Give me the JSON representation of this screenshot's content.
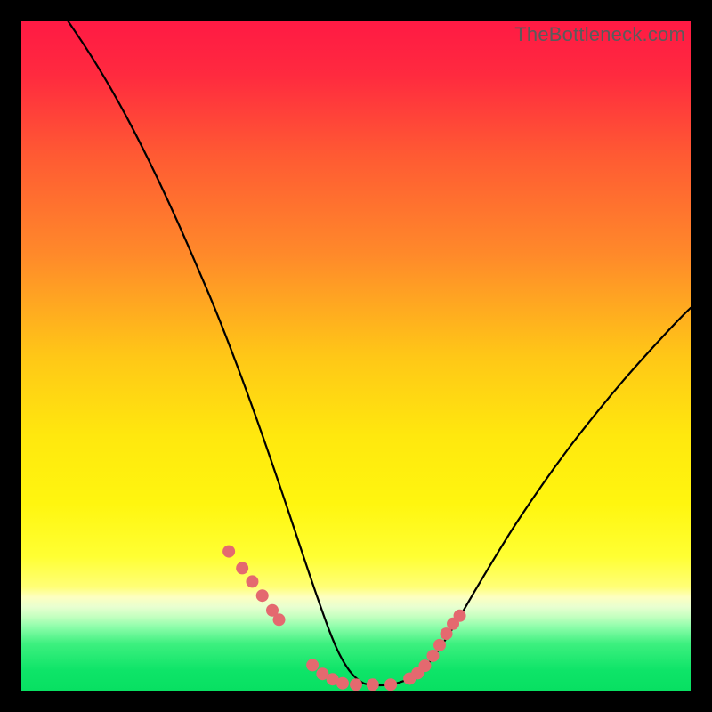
{
  "watermark": "TheBottleneck.com",
  "chart_data": {
    "type": "line",
    "title": "",
    "xlabel": "",
    "ylabel": "",
    "xlim": [
      0,
      100
    ],
    "ylim": [
      0,
      100
    ],
    "grid": false,
    "legend": false,
    "gradient_stops": [
      {
        "offset": 0.0,
        "color": "#ff1a44"
      },
      {
        "offset": 0.08,
        "color": "#ff2a3f"
      },
      {
        "offset": 0.2,
        "color": "#ff5a33"
      },
      {
        "offset": 0.35,
        "color": "#ff8a2a"
      },
      {
        "offset": 0.5,
        "color": "#ffc717"
      },
      {
        "offset": 0.62,
        "color": "#ffe80e"
      },
      {
        "offset": 0.72,
        "color": "#fff60f"
      },
      {
        "offset": 0.8,
        "color": "#ffff33"
      },
      {
        "offset": 0.845,
        "color": "#ffff77"
      },
      {
        "offset": 0.86,
        "color": "#fdffc0"
      },
      {
        "offset": 0.875,
        "color": "#e8ffd0"
      },
      {
        "offset": 0.89,
        "color": "#c2ffbf"
      },
      {
        "offset": 0.905,
        "color": "#8dfdaa"
      },
      {
        "offset": 0.93,
        "color": "#3df07f"
      },
      {
        "offset": 0.97,
        "color": "#0ee468"
      },
      {
        "offset": 1.0,
        "color": "#08e062"
      }
    ],
    "series": [
      {
        "name": "bottleneck-curve",
        "x": [
          7,
          10,
          13,
          16,
          19,
          22,
          25,
          28,
          30,
          32,
          34,
          36,
          38,
          40,
          42,
          44,
          46,
          47.5,
          49,
          50.5,
          52,
          55,
          58,
          60,
          62,
          65,
          68,
          71,
          74,
          78,
          82,
          86,
          90,
          94,
          98,
          100
        ],
        "y": [
          100,
          95.5,
          90.6,
          85.2,
          79.3,
          73.0,
          66.3,
          59.3,
          54.4,
          49.2,
          43.8,
          38.2,
          32.4,
          26.5,
          20.5,
          14.6,
          9.0,
          5.5,
          3.0,
          1.5,
          0.9,
          0.9,
          1.8,
          3.2,
          5.6,
          10.2,
          15.3,
          20.3,
          25.1,
          31.0,
          36.5,
          41.6,
          46.4,
          50.9,
          55.2,
          57.2
        ]
      }
    ],
    "markers": {
      "name": "sample-points",
      "color": "#e4696f",
      "x": [
        31.0,
        33.0,
        34.5,
        36.0,
        37.5,
        38.5,
        43.5,
        45.0,
        46.5,
        48.0,
        50.0,
        52.5,
        55.2,
        58.0,
        59.2,
        60.3,
        61.5,
        62.5,
        63.5,
        64.5,
        65.5
      ],
      "y": [
        20.8,
        18.3,
        16.3,
        14.2,
        12.0,
        10.6,
        3.8,
        2.5,
        1.7,
        1.1,
        0.9,
        0.9,
        0.9,
        1.8,
        2.6,
        3.7,
        5.2,
        6.8,
        8.5,
        10.0,
        11.2
      ]
    }
  }
}
